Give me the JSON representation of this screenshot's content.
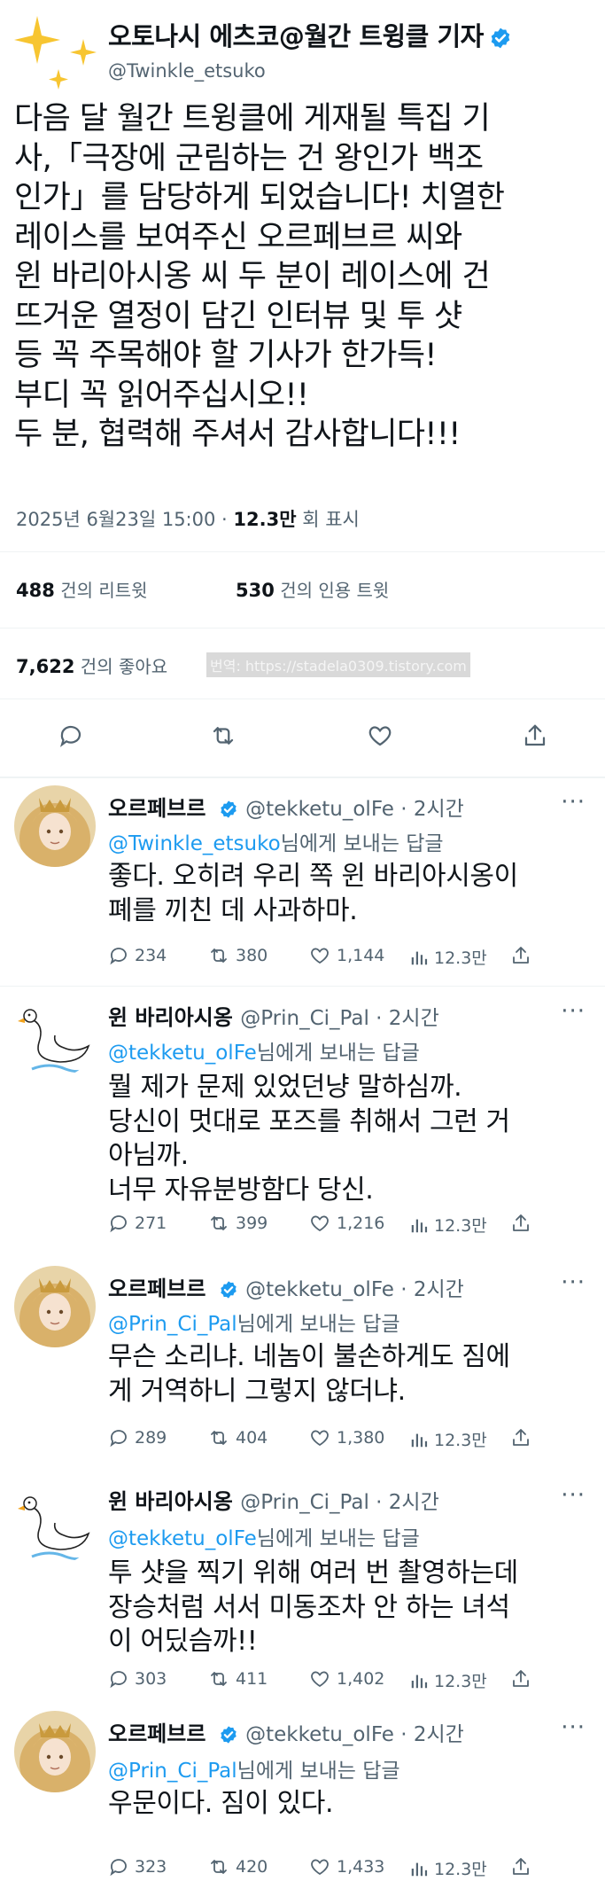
{
  "tweet": {
    "author_name": "오토나시 에츠코@월간 트윙클 기자",
    "author_handle": "@Twinkle_etsuko",
    "lines": [
      "다음 달 월간 트윙클에 게재될 특집 기",
      "사,「극장에 군림하는 건 왕인가 백조",
      "인가」를 담당하게 되었습니다! 치열한",
      "레이스를 보여주신 오르페브르 씨와",
      "윈 바리아시옹 씨 두 분이 레이스에 건",
      "뜨거운 열정이 담긴 인터뷰 및 투 샷",
      "등 꼭 주목해야 할 기사가 한가득!",
      "부디 꼭 읽어주십시오!!",
      "두 분, 협력해 주셔서 감사합니다!!!"
    ],
    "datetime": "2025년 6월23일 15:00 ·",
    "views_count": "12.3만",
    "views_label": "회 표시",
    "retweets_count": "488",
    "retweets_label": "건의 리트윗",
    "quotes_count": "530",
    "quotes_label": "건의 인용 트윗",
    "likes_count": "7,622",
    "likes_label": "건의 좋아요",
    "translator_note": "번역: https://stadela0309.tistory.com"
  },
  "replies": [
    {
      "name": "오르페브르",
      "handle": "@tekketu_olFe · 2시간",
      "reply_to": "@Twinkle_etsuko",
      "reply_suffix": "님에게 보내는 답글",
      "lines": [
        "좋다. 오히려 우리 쪽 윈 바리아시옹이",
        "폐를 끼친 데 사과하마."
      ],
      "comments": "234",
      "retweets": "380",
      "likes": "1,144",
      "views": "12.3만",
      "avatar": "gold-haired-horse-girl",
      "verified": true
    },
    {
      "name": "윈 바리아시옹",
      "handle": "@Prin_Ci_Pal · 2시간",
      "reply_to": "@tekketu_olFe",
      "reply_suffix": "님에게 보내는 답글",
      "lines": [
        "뭘 제가 문제 있었던냥 말하심까.",
        "당신이 멋대로 포즈를 취해서 그런 거",
        "아님까.",
        "너무 자유분방함다 당신."
      ],
      "comments": "271",
      "retweets": "399",
      "likes": "1,216",
      "views": "12.3만",
      "avatar": "swan-drawing",
      "verified": false
    },
    {
      "name": "오르페브르",
      "handle": "@tekketu_olFe · 2시간",
      "reply_to": "@Prin_Ci_Pal",
      "reply_suffix": "님에게 보내는 답글",
      "lines": [
        "무슨 소리냐. 네놈이 불손하게도 짐에",
        "게 거역하니 그렇지 않더냐."
      ],
      "comments": "289",
      "retweets": "404",
      "likes": "1,380",
      "views": "12.3만",
      "avatar": "gold-haired-horse-girl",
      "verified": true
    },
    {
      "name": "윈 바리아시옹",
      "handle": "@Prin_Ci_Pal · 2시간",
      "reply_to": "@tekketu_olFe",
      "reply_suffix": "님에게 보내는 답글",
      "lines": [
        "투 샷을 찍기 위해 여러 번 촬영하는데",
        "장승처럼 서서 미동조차 안 하는 녀석",
        "이 어딨슴까!!"
      ],
      "comments": "303",
      "retweets": "411",
      "likes": "1,402",
      "views": "12.3만",
      "avatar": "swan-drawing",
      "verified": false
    },
    {
      "name": "오르페브르",
      "handle": "@tekketu_olFe · 2시간",
      "reply_to": "@Prin_Ci_Pal",
      "reply_suffix": "님에게 보내는 답글",
      "lines": [
        "우문이다. 짐이 있다."
      ],
      "comments": "323",
      "retweets": "420",
      "likes": "1,433",
      "views": "12.3만",
      "avatar": "gold-haired-horse-girl",
      "verified": true
    }
  ],
  "colors": {
    "accent": "#1d9bf0",
    "muted": "#536471",
    "text": "#0f1419",
    "divider": "#eff3f4"
  }
}
